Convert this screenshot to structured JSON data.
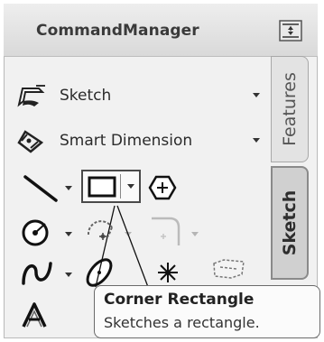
{
  "panel": {
    "title": "CommandManager",
    "pin_icon": "pin-icon"
  },
  "menu": [
    {
      "label": "Sketch",
      "icon": "sketch-icon"
    },
    {
      "label": "Smart Dimension",
      "icon": "smart-dimension-icon"
    }
  ],
  "tabs": [
    {
      "label": "Features",
      "active": false
    },
    {
      "label": "Sketch",
      "active": true
    }
  ],
  "tools": [
    {
      "name": "line-icon"
    },
    {
      "name": "corner-rectangle-icon"
    },
    {
      "name": "polygon-icon"
    },
    {
      "name": "circle-icon"
    },
    {
      "name": "centerpoint-arc-icon"
    },
    {
      "name": "sketch-fillet-icon"
    },
    {
      "name": "spline-icon"
    },
    {
      "name": "ellipse-icon"
    },
    {
      "name": "point-icon"
    },
    {
      "name": "text-icon"
    }
  ],
  "tooltip": {
    "title": "Corner Rectangle",
    "description": "Sketches a rectangle."
  }
}
